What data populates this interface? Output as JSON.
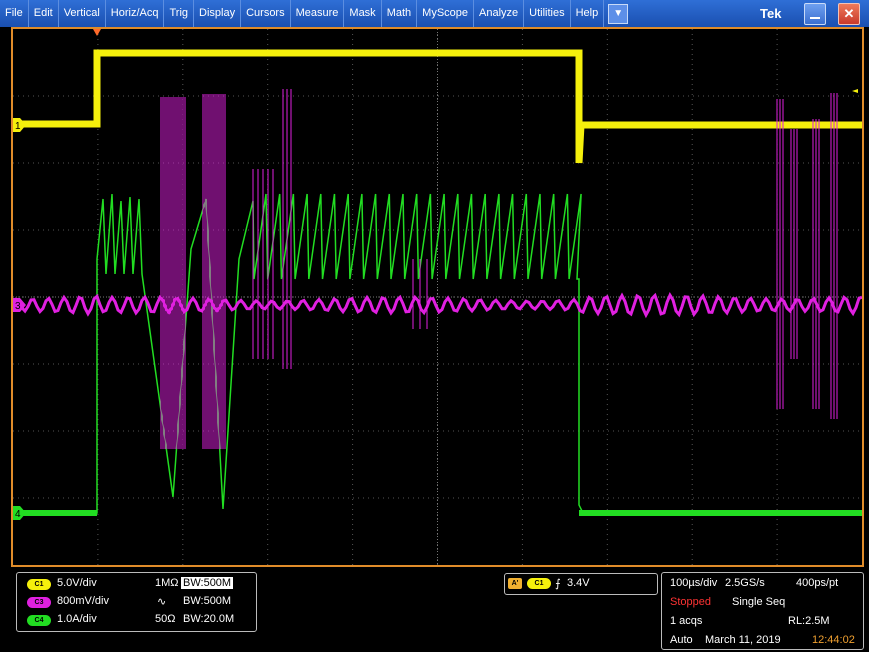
{
  "menu": {
    "items": [
      "File",
      "Edit",
      "Vertical",
      "Horiz/Acq",
      "Trig",
      "Display",
      "Cursors",
      "Measure",
      "Mask",
      "Math",
      "MyScope",
      "Analyze",
      "Utilities",
      "Help"
    ],
    "dropdown_glyph": "▼",
    "brand": "Tek",
    "close_glyph": "✕"
  },
  "colors": {
    "ch1": "#f5f00c",
    "ch3": "#e020e0",
    "ch4": "#22dd22",
    "grid": "#555555",
    "frame": "#e08c2a"
  },
  "markers": {
    "ch1": "1",
    "ch3": "3",
    "ch4": "4"
  },
  "vertical": {
    "ch1": {
      "badge": "C1",
      "scale": "5.0V/div",
      "coupling": "1MΩ",
      "bw": "BW:500M"
    },
    "ch3": {
      "badge": "C3",
      "scale": "800mV/div",
      "coupling": "∿",
      "bw": "BW:500M"
    },
    "ch4": {
      "badge": "C4",
      "scale": "1.0A/div",
      "coupling": "50Ω",
      "bw": "BW:20.0M"
    }
  },
  "trigger": {
    "mode_badge": "A'",
    "source_badge": "C1",
    "slope": "⨍",
    "level": "3.4V"
  },
  "horizontal": {
    "scale": "100µs/div",
    "sample_rate": "2.5GS/s",
    "resolution": "400ps/pt",
    "state": "Stopped",
    "sequence": "Single Seq",
    "acqs": "1 acqs",
    "record_length": "RL:2.5M",
    "mode": "Auto",
    "date": "March 11, 2019",
    "time": "12:44:02"
  }
}
